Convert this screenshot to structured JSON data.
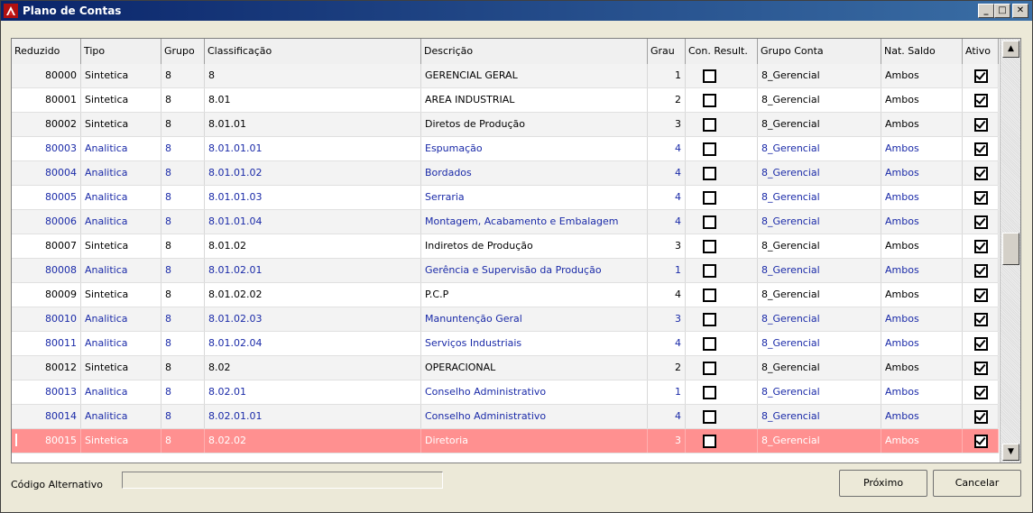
{
  "window": {
    "title": "Plano de Contas"
  },
  "columns": [
    {
      "key": "reduzido",
      "label": "Reduzido"
    },
    {
      "key": "tipo",
      "label": "Tipo"
    },
    {
      "key": "grupo",
      "label": "Grupo"
    },
    {
      "key": "classificacao",
      "label": "Classificação"
    },
    {
      "key": "descricao",
      "label": "Descrição"
    },
    {
      "key": "grau",
      "label": "Grau"
    },
    {
      "key": "con_result",
      "label": "Con. Result."
    },
    {
      "key": "grupo_conta",
      "label": "Grupo Conta"
    },
    {
      "key": "nat_saldo",
      "label": "Nat. Saldo"
    },
    {
      "key": "ativo",
      "label": "Ativo"
    }
  ],
  "rows": [
    {
      "reduzido": "80000",
      "tipo": "Sintetica",
      "grupo": "8",
      "classificacao": "8",
      "descricao": "GERENCIAL GERAL",
      "grau": "1",
      "con_result": false,
      "grupo_conta": "8_Gerencial",
      "nat_saldo": "Ambos",
      "ativo": true,
      "blue": false
    },
    {
      "reduzido": "80001",
      "tipo": "Sintetica",
      "grupo": "8",
      "classificacao": "8.01",
      "descricao": "AREA INDUSTRIAL",
      "grau": "2",
      "con_result": false,
      "grupo_conta": "8_Gerencial",
      "nat_saldo": "Ambos",
      "ativo": true,
      "blue": false
    },
    {
      "reduzido": "80002",
      "tipo": "Sintetica",
      "grupo": "8",
      "classificacao": "8.01.01",
      "descricao": "Diretos de Produção",
      "grau": "3",
      "con_result": false,
      "grupo_conta": "8_Gerencial",
      "nat_saldo": "Ambos",
      "ativo": true,
      "blue": false
    },
    {
      "reduzido": "80003",
      "tipo": "Analitica",
      "grupo": "8",
      "classificacao": "8.01.01.01",
      "descricao": "Espumação",
      "grau": "4",
      "con_result": false,
      "grupo_conta": "8_Gerencial",
      "nat_saldo": "Ambos",
      "ativo": true,
      "blue": true
    },
    {
      "reduzido": "80004",
      "tipo": "Analitica",
      "grupo": "8",
      "classificacao": "8.01.01.02",
      "descricao": "Bordados",
      "grau": "4",
      "con_result": false,
      "grupo_conta": "8_Gerencial",
      "nat_saldo": "Ambos",
      "ativo": true,
      "blue": true
    },
    {
      "reduzido": "80005",
      "tipo": "Analitica",
      "grupo": "8",
      "classificacao": "8.01.01.03",
      "descricao": "Serraria",
      "grau": "4",
      "con_result": false,
      "grupo_conta": "8_Gerencial",
      "nat_saldo": "Ambos",
      "ativo": true,
      "blue": true
    },
    {
      "reduzido": "80006",
      "tipo": "Analitica",
      "grupo": "8",
      "classificacao": "8.01.01.04",
      "descricao": "Montagem, Acabamento e Embalagem",
      "grau": "4",
      "con_result": false,
      "grupo_conta": "8_Gerencial",
      "nat_saldo": "Ambos",
      "ativo": true,
      "blue": true
    },
    {
      "reduzido": "80007",
      "tipo": "Sintetica",
      "grupo": "8",
      "classificacao": "8.01.02",
      "descricao": "Indiretos de Produção",
      "grau": "3",
      "con_result": false,
      "grupo_conta": "8_Gerencial",
      "nat_saldo": "Ambos",
      "ativo": true,
      "blue": false
    },
    {
      "reduzido": "80008",
      "tipo": "Analitica",
      "grupo": "8",
      "classificacao": "8.01.02.01",
      "descricao": "Gerência e Supervisão da Produção",
      "grau": "1",
      "con_result": false,
      "grupo_conta": "8_Gerencial",
      "nat_saldo": "Ambos",
      "ativo": true,
      "blue": true
    },
    {
      "reduzido": "80009",
      "tipo": "Sintetica",
      "grupo": "8",
      "classificacao": "8.01.02.02",
      "descricao": "P.C.P",
      "grau": "4",
      "con_result": false,
      "grupo_conta": "8_Gerencial",
      "nat_saldo": "Ambos",
      "ativo": true,
      "blue": false
    },
    {
      "reduzido": "80010",
      "tipo": "Analitica",
      "grupo": "8",
      "classificacao": "8.01.02.03",
      "descricao": "Manuntenção Geral",
      "grau": "3",
      "con_result": false,
      "grupo_conta": "8_Gerencial",
      "nat_saldo": "Ambos",
      "ativo": true,
      "blue": true
    },
    {
      "reduzido": "80011",
      "tipo": "Analitica",
      "grupo": "8",
      "classificacao": "8.01.02.04",
      "descricao": "Serviços Industriais",
      "grau": "4",
      "con_result": false,
      "grupo_conta": "8_Gerencial",
      "nat_saldo": "Ambos",
      "ativo": true,
      "blue": true
    },
    {
      "reduzido": "80012",
      "tipo": "Sintetica",
      "grupo": "8",
      "classificacao": "8.02",
      "descricao": "OPERACIONAL",
      "grau": "2",
      "con_result": false,
      "grupo_conta": "8_Gerencial",
      "nat_saldo": "Ambos",
      "ativo": true,
      "blue": false
    },
    {
      "reduzido": "80013",
      "tipo": "Analitica",
      "grupo": "8",
      "classificacao": "8.02.01",
      "descricao": "Conselho Administrativo",
      "grau": "1",
      "con_result": false,
      "grupo_conta": "8_Gerencial",
      "nat_saldo": "Ambos",
      "ativo": true,
      "blue": true
    },
    {
      "reduzido": "80014",
      "tipo": "Analitica",
      "grupo": "8",
      "classificacao": "8.02.01.01",
      "descricao": "Conselho Administrativo",
      "grau": "4",
      "con_result": false,
      "grupo_conta": "8_Gerencial",
      "nat_saldo": "Ambos",
      "ativo": true,
      "blue": true
    },
    {
      "reduzido": "80015",
      "tipo": "Sintetica",
      "grupo": "8",
      "classificacao": "8.02.02",
      "descricao": "Diretoria",
      "grau": "3",
      "con_result": false,
      "grupo_conta": "8_Gerencial",
      "nat_saldo": "Ambos",
      "ativo": true,
      "blue": false,
      "selected": true
    }
  ],
  "footer": {
    "alt_code_label": "Código Alternativo",
    "alt_code_value": "",
    "next_label": "Próximo",
    "cancel_label": "Cancelar"
  },
  "colors": {
    "selected_row": "#ff9090",
    "link_blue": "#1a2aa8",
    "title_start": "#0a246a"
  }
}
